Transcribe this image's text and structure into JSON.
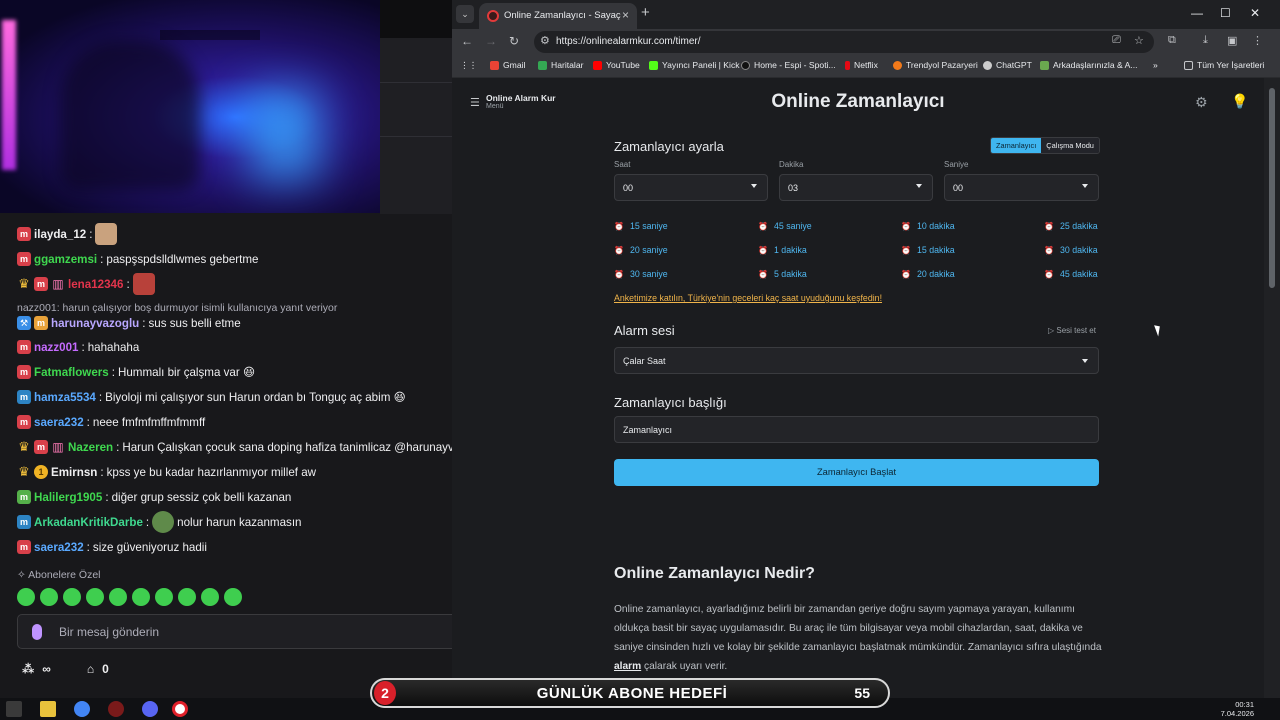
{
  "chat": {
    "messages": [
      {
        "user": "ilayda_12",
        "text": "",
        "color": "#efeff1"
      },
      {
        "user": "ggamzemsi",
        "text": "paspşspdslldlwmes gebertme",
        "color": "#3fd84f"
      },
      {
        "user": "lena12346",
        "text": "",
        "color": "#e2344c"
      },
      {
        "user": "harunayvazoglu",
        "text": "sus sus belli etme",
        "color": "#b9a7ff"
      },
      {
        "user": "nazz001",
        "text": "hahahaha",
        "color": "#c56bff"
      },
      {
        "user": "Fatmaflowers",
        "text": "Hummalı bir çalşma var 😆",
        "color": "#3fd84f"
      },
      {
        "user": "hamza5534",
        "text": "Biyoloji mi çalışıyor sun Harun ordan bı Tonguç aç abim 😆",
        "color": "#5aa9ff"
      },
      {
        "user": "saera232",
        "text": "neee fmfmfmffmfmmff",
        "color": "#5aa9ff"
      },
      {
        "user": "Nazeren",
        "text": "Harun Çalışkan çocuk sana doping hafiza tanimlicaz @harunayva",
        "color": "#3fd84f"
      },
      {
        "user": "Emirnsn",
        "text": "kpss ye bu kadar hazırlanmıyor millef aw",
        "color": "#efeff1"
      },
      {
        "user": "Halilerg1905",
        "text": "diğer grup sessiz çok belli kazanan",
        "color": "#3fd84f"
      },
      {
        "user": "ArkadanKritikDarbe",
        "text": "nolur harun kazanmasın",
        "color": "#3fd88f"
      },
      {
        "user": "saera232",
        "text": "size güveniyoruz hadii",
        "color": "#5aa9ff"
      }
    ],
    "reply_line": "nazz001: harun çalışıyor boş durmuyor isimli kullanıcıya yanıt veriyor",
    "subs_label": "Abonelere Özel",
    "input_placeholder": "Bir mesaj gönderin",
    "viewers": "∞",
    "shop_count": "0"
  },
  "browser": {
    "tab_title": "Online Zamanlayıcı - Sayaç",
    "url": "https://onlinealarmkur.com/timer/",
    "bookmarks": [
      "Gmail",
      "Haritalar",
      "YouTube",
      "Yayıncı Paneli | Kick",
      "Home - Espi - Spoti...",
      "Netflix",
      "Trendyol Pazaryeri",
      "ChatGPT",
      "Arkadaşlarınızla & A...",
      "Tüm Yer İşaretleri"
    ]
  },
  "page": {
    "brand": "Online Alarm Kur",
    "brand_sub": "Menü",
    "title": "Online Zamanlayıcı",
    "settings_title": "Zamanlayıcı ayarla",
    "mode_on": "Zamanlayıcı",
    "mode_off": "Çalışma Modu",
    "labels": {
      "hour": "Saat",
      "minute": "Dakika",
      "second": "Saniye"
    },
    "values": {
      "hour": "00",
      "minute": "03",
      "second": "00"
    },
    "presets": [
      "15 saniye",
      "45 saniye",
      "10 dakika",
      "25 dakika",
      "20 saniye",
      "1 dakika",
      "15 dakika",
      "30 dakika",
      "30 saniye",
      "5 dakika",
      "20 dakika",
      "45 dakika"
    ],
    "survey": "Anketimize katılın, Türkiye'nin geceleri kaç saat uyuduğunu keşfedin!",
    "alarm_title": "Alarm sesi",
    "test_sound": "Sesi test et",
    "alarm_value": "Çalar Saat",
    "timer_title_label": "Zamanlayıcı başlığı",
    "timer_title_value": "Zamanlayıcı",
    "start_button": "Zamanlayıcı Başlat",
    "about_title": "Online Zamanlayıcı Nedir?",
    "about_text_1": "Online zamanlayıcı, ayarladığınız belirli bir zamandan geriye doğru sayım yapmaya yarayan, kullanımı oldukça basit bir sayaç uygulamasıdır. Bu araç ile tüm bilgisayar veya mobil cihazlardan, saat, dakika ve saniye cinsinden hızlı ve kolay bir şekilde zamanlayıcı başlatmak mümkündür. Zamanlayıcı sıfıra ulaştığında ",
    "about_link": "alarm",
    "about_text_2": " çalarak uyarı verir."
  },
  "overlay": {
    "goal_current": "2",
    "goal_text": "GÜNLÜK ABONE HEDEFİ",
    "goal_target": "55"
  },
  "taskbar": {
    "clock_time": "00:31",
    "clock_date": "7.04.2026"
  }
}
